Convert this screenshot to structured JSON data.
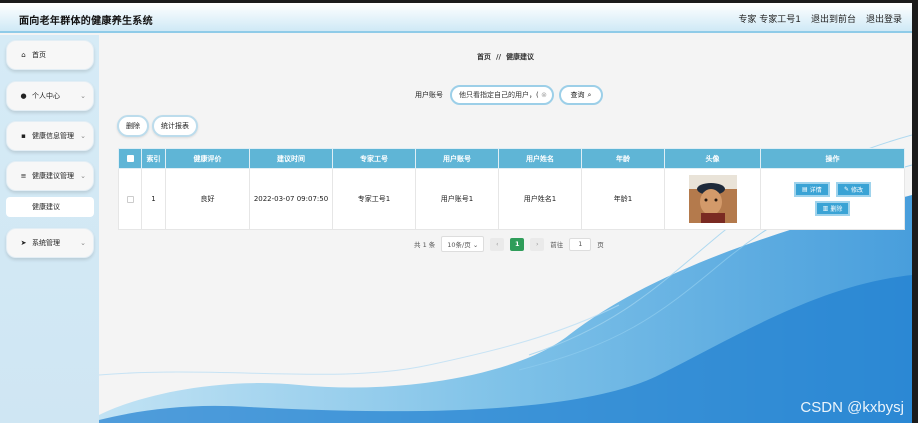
{
  "app": {
    "title": "面向老年群体的健康养生系统"
  },
  "header": {
    "role": "专家",
    "user": "专家工号1",
    "back_to_front": "退出到前台",
    "logout": "退出登录"
  },
  "sidebar": {
    "items": [
      {
        "label": "首页",
        "icon": "home-icon"
      },
      {
        "label": "个人中心",
        "icon": "user-icon"
      },
      {
        "label": "健康信息管理",
        "icon": "grid-icon"
      },
      {
        "label": "健康建议管理",
        "icon": "list-icon"
      },
      {
        "label": "系统管理",
        "icon": "send-icon"
      }
    ],
    "sub": {
      "label": "健康建议"
    }
  },
  "breadcrumb": {
    "home": "首页",
    "sep": "//",
    "current": "健康建议"
  },
  "search": {
    "label": "用户账号",
    "value": "他只看指定自己的用户，(",
    "button": "查询"
  },
  "actions": {
    "delete": "删除",
    "report": "统计报表"
  },
  "table": {
    "headers": [
      "索引",
      "健康评价",
      "建议时间",
      "专家工号",
      "用户账号",
      "用户姓名",
      "年龄",
      "头像",
      "操作"
    ],
    "rows": [
      {
        "index": "1",
        "evaluation": "良好",
        "time": "2022-03-07 09:07:50",
        "expert_id": "专家工号1",
        "account": "用户账号1",
        "name": "用户姓名1",
        "age": "年龄1"
      }
    ],
    "ops": {
      "detail": "详情",
      "edit": "修改",
      "delete": "删除"
    }
  },
  "pager": {
    "total": "共 1 条",
    "page_size": "10条/页",
    "current": "1",
    "goto_label": "前往",
    "goto_value": "1",
    "page_suffix": "页"
  },
  "watermark": "CSDN @kxbysj",
  "colors": {
    "accent": "#5fb5d6",
    "button": "#3aa3d5",
    "pager_active": "#2f9d5a"
  }
}
